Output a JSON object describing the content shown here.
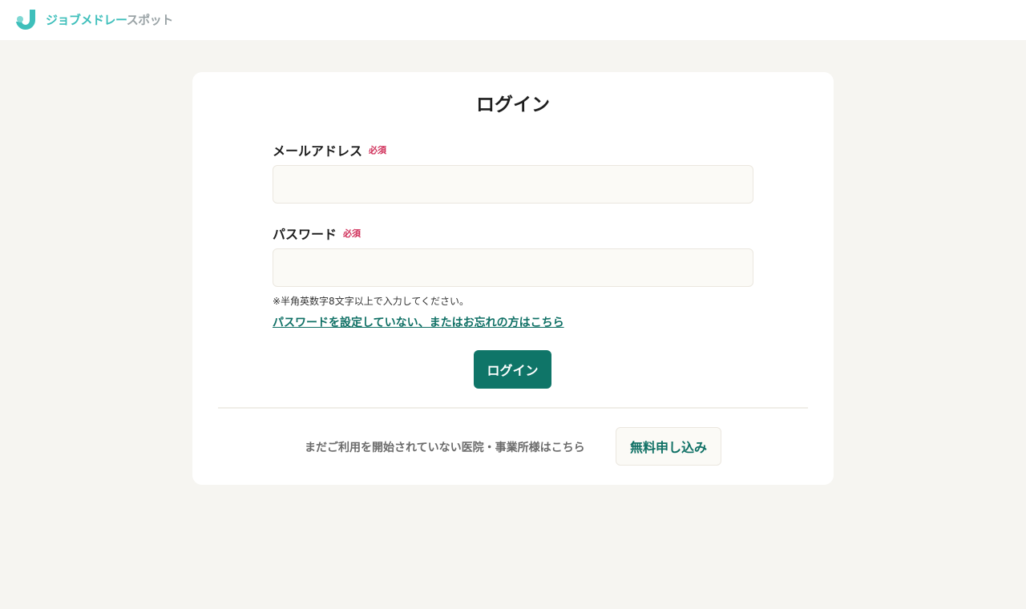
{
  "header": {
    "logo_text_primary": "ジョブメドレー",
    "logo_text_secondary": "スポット",
    "logo_icon": "j-logo-icon",
    "brand_color": "#3ebfbb"
  },
  "login": {
    "title": "ログイン",
    "email": {
      "label": "メールアドレス",
      "required": "必須",
      "value": ""
    },
    "password": {
      "label": "パスワード",
      "required": "必須",
      "value": "",
      "hint": "※半角英数字8文字以上で入力してください。"
    },
    "forgot_link": "パスワードを設定していない、またはお忘れの方はこちら",
    "submit_label": "ログイン",
    "accent_color": "#0f7568",
    "required_color": "#d0305a"
  },
  "signup": {
    "text": "まだご利用を開始されていない医院・事業所様はこちら",
    "button_label": "無料申し込み"
  }
}
